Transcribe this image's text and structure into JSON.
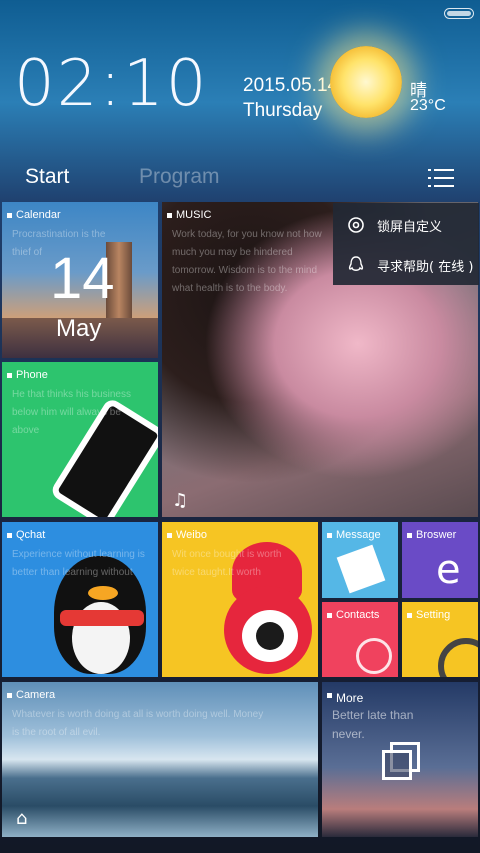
{
  "status_bar": {
    "battery_icon": "battery-icon"
  },
  "clock": {
    "time": "02:10",
    "date": "2015.05.14",
    "weekday": "Thursday"
  },
  "weather": {
    "desc": "晴",
    "temp": "23°C",
    "icon": "sun-icon"
  },
  "tabs": [
    {
      "label": "Start"
    },
    {
      "label": "Program"
    }
  ],
  "menu_icon": "list-menu-icon",
  "dropdown": [
    {
      "label": "锁屏自定义",
      "icon": "gear-icon"
    },
    {
      "label": "寻求帮助( 在线 )",
      "icon": "qq-icon"
    }
  ],
  "tiles": {
    "calendar": {
      "name": "Calendar",
      "motto": "Procrastination is the thief of",
      "day": "14",
      "month": "May"
    },
    "phone": {
      "name": "Phone",
      "motto": "He that thinks his business below him will always be above"
    },
    "music": {
      "name": "MUSIC",
      "motto": "Work today, for you know not how much you may be hindered tomorrow. Wisdom is to the mind what health is to the body."
    },
    "qchat": {
      "name": "Qchat",
      "motto": "Experience without learning is better than learning without"
    },
    "weibo": {
      "name": "Weibo",
      "motto": "Wit once bought is worth twice taught.It worth"
    },
    "message": {
      "name": "Message"
    },
    "browser": {
      "name": "Broswer"
    },
    "contacts": {
      "name": "Contacts"
    },
    "setting": {
      "name": "Setting"
    },
    "camera": {
      "name": "Camera",
      "motto": "Whatever is worth doing at all is worth doing well. Money is the root of all evil."
    },
    "more": {
      "name": "More",
      "motto": "Better late than never."
    }
  },
  "colors": {
    "phone": "#2dc46e",
    "qchat": "#2d8ee0",
    "weibo": "#f6c523",
    "message": "#55b7e6",
    "browser": "#6a4bc6",
    "contacts": "#f0425e",
    "setting": "#f6c523"
  }
}
